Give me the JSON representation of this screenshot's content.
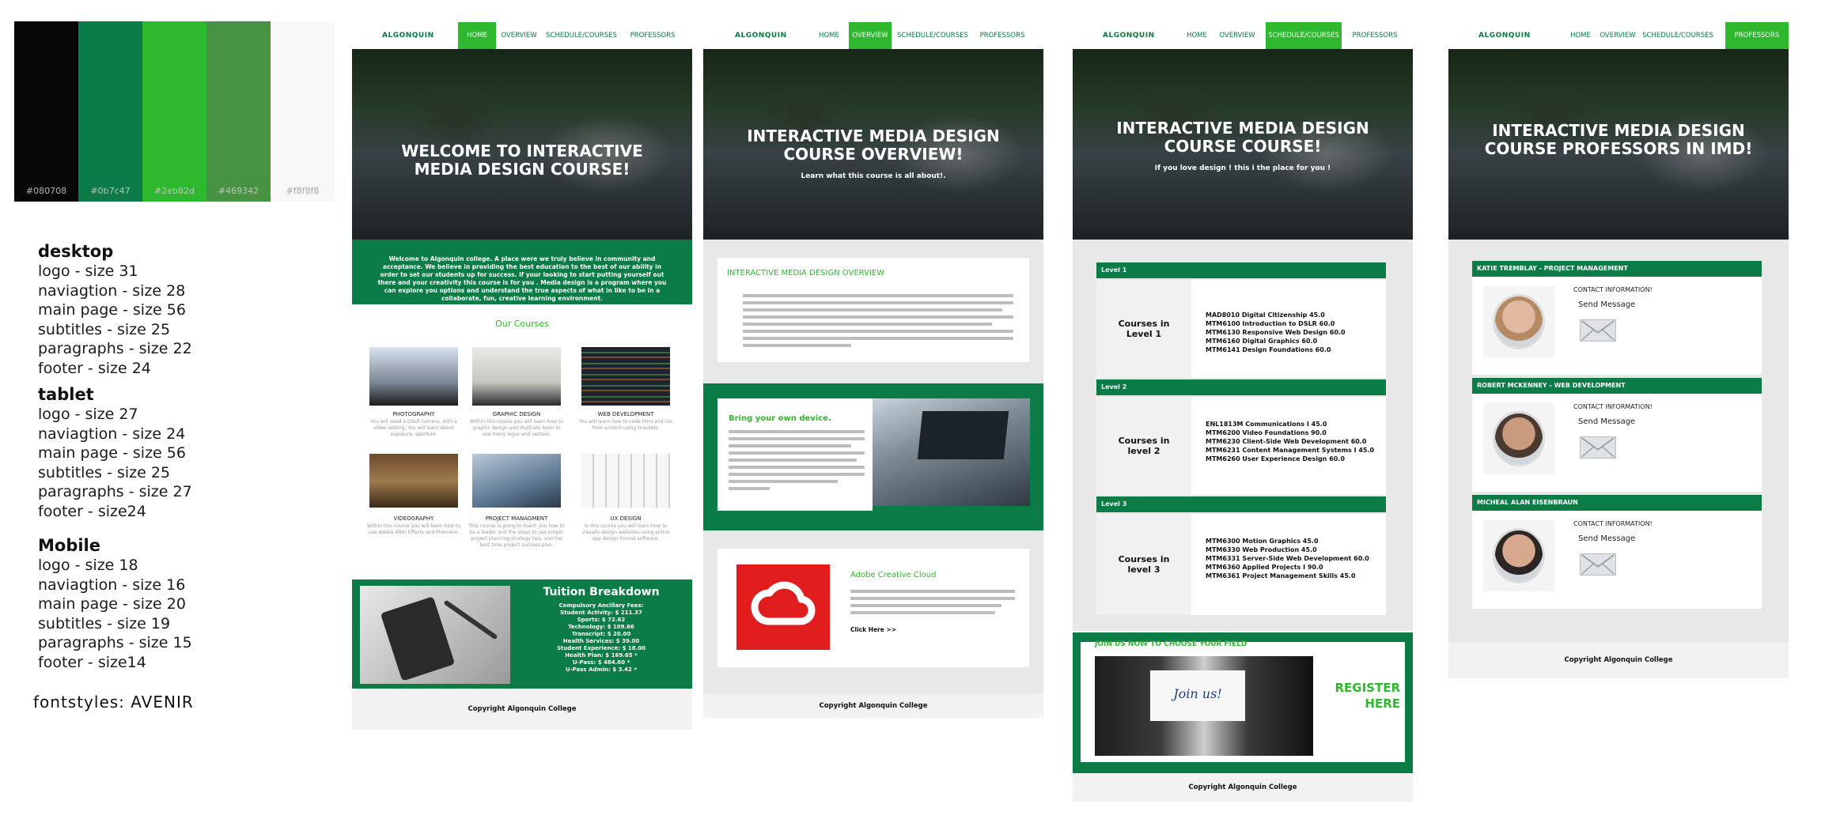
{
  "palette": [
    {
      "hex": "#080708",
      "label": "#080708"
    },
    {
      "hex": "#0b7c47",
      "label": "#0b7c47"
    },
    {
      "hex": "#2eb82d",
      "label": "#2eb82d"
    },
    {
      "hex": "#469342",
      "label": "#469342"
    },
    {
      "hex": "#f8f8f8",
      "label": "#f8f8f8"
    }
  ],
  "spec": {
    "desktop": {
      "heading": "desktop",
      "lines": [
        "logo - size 31",
        "naviagtion - size 28",
        "main page - size 56",
        "subtitles - size 25",
        "paragraphs - size 22",
        "footer - size 24"
      ]
    },
    "tablet": {
      "heading": "tablet",
      "lines": [
        "logo - size 27",
        "naviagtion - size 24",
        "main page - size 56",
        "subtitles - size 25",
        "paragraphs -  size 27",
        "footer - size24"
      ]
    },
    "mobile": {
      "heading": "Mobile",
      "lines": [
        "logo - size 18",
        "naviagtion - size 16",
        "main page - size 20",
        "subtitles - size 19",
        "paragraphs - size 15",
        "footer - size14"
      ]
    },
    "fontstyles": "fontstyles:  AVENIR"
  },
  "nav": {
    "logo": "ALGONQUIN",
    "home": "HOME",
    "overview": "OVERVIEW",
    "schedule": "SCHEDULE/COURSES",
    "professors": "PROFESSORS"
  },
  "home": {
    "hero_line1": "WELCOME TO INTERACTIVE",
    "hero_line2": "MEDIA DESIGN COURSE!",
    "welcome": "Welcome to Algonquin college. A place were we truly believe in community and acceptance. We believe in providing the best education to the best of our ability in order to set our students up for success. If your looking to start putting yourself out there and your  creativity this course is for you .  Media design is a program where you can explore you options and understand the true aspects of what in like to be in a collaborate, fun, creative  learning environment.",
    "courses_heading": "Our Courses",
    "courses": [
      {
        "title": "PHOTOGRAPHY",
        "desc": "You will need a DSLR camera, with a video setting. You will learn about exposure, aperture."
      },
      {
        "title": "GRAPHIC DESIGN",
        "desc": "Within this course you will learn how to graphic design and illustrate learn to use many logos and vectors."
      },
      {
        "title": "WEB DEVELOPMENT",
        "desc": "You will learn how to code html and css from scratch using brackets."
      },
      {
        "title": "VIDEOGRAPHY",
        "desc": "Within this course you will learn how to use Adobe After Effects and Premiere."
      },
      {
        "title": "PROJECT MANAGMENT",
        "desc": "This course is going to teach you how to be a leader and the steps to use proper project planning strategy tips, and the best time project success plan."
      },
      {
        "title": "UX DESIGN",
        "desc": "In this course you will learn how to visually design websites using online app design format software."
      }
    ],
    "tuition_title": "Tuition Breakdown",
    "fees": [
      "Compulsory Ancillary Fees:",
      "Student Activity: $ 211.37",
      "Sports: $ 72.62",
      "Technology: $ 109.66",
      "Transcript: $ 20.00",
      "Health Services: $ 39.00",
      "Student Experience: $ 18.00",
      "Health Plan: $ 169.65 *",
      "U-Pass: $ 484.60 *",
      "U-Pass Admin: $ 3.42 *"
    ],
    "footer": "Copyright Algonquin College"
  },
  "overview": {
    "hero_line1": "INTERACTIVE MEDIA DESIGN",
    "hero_line2": "COURSE OVERVIEW!",
    "hero_sub": "Learn what this course is all about!.",
    "section_title": "INTERACTIVE MEDIA DESIGN OVERVIEW",
    "device_title": "Bring your own device.",
    "adobe_title": "Adobe Creative Cloud",
    "click_here": "Click Here >>",
    "footer": "Copyright  Algonquin College"
  },
  "schedule": {
    "hero_line1": "INTERACTIVE MEDIA DESIGN",
    "hero_line2": "COURSE COURSE!",
    "hero_sub": "If you love design ! this i the place for you !",
    "levels": [
      {
        "bar": "Level 1",
        "label_1": "Courses in",
        "label_2": "Level 1",
        "courses": [
          "MAD8010 Digital Citizenship   45.0",
          "MTM6100 Introduction to DSLR   60.0",
          "MTM6130 Responsive Web Design   60.0",
          "MTM6160 Digital Graphics   60.0",
          "MTM6141 Design Foundations 60.0"
        ]
      },
      {
        "bar": "Level 2",
        "label_1": "Courses in",
        "label_2": "level 2",
        "courses": [
          "ENL1813M Communications I   45.0",
          "MTM6200 Video Foundations  90.0",
          "MTM6230 Client-Side Web Development   60.0",
          "MTM6231 Content Management Systems I   45.0",
          "MTM6260 User Experience Design   60.0"
        ]
      },
      {
        "bar": "Level 3",
        "label_1": "Courses in",
        "label_2": "level 3",
        "courses": [
          "MTM6300 Motion Graphics  45.0",
          "MTM6330 Web Production   45.0",
          "MTM6331 Server-Side Web Development  60.0",
          "MTM6360 Applied Projects I   90.0",
          "MTM6361 Project Management Skills   45.0"
        ]
      }
    ],
    "join_title": "JOIN US NOW TO CHOOSE YOUR FIELD",
    "join_card": "Join us!",
    "register_1": "REGISTER",
    "register_2": "HERE",
    "footer": "Copyright Algonquin College"
  },
  "professors": {
    "hero_line1": "INTERACTIVE MEDIA DESIGN",
    "hero_line2": "COURSE PROFESSORS IN IMD!",
    "profs": [
      {
        "name": "KATIE TREMBLAY - PROJECT MANAGEMENT",
        "contact": "CONTACT INFORMATION!",
        "send": "Send Message",
        "skin": "#e0b9a0",
        "hair": "#b58a62"
      },
      {
        "name": "ROBERT MCKENNEY - WEB DEVELOPMENT",
        "contact": "CONTACT INFORMATION!",
        "send": "Send Message",
        "skin": "#c99a7d",
        "hair": "#4a3a30"
      },
      {
        "name": "MICHEAL ALAN EISENBRAUN",
        "contact": "CONTACT INFORMATION!",
        "send": "Send Message",
        "skin": "#d8a88e",
        "hair": "#2b2523"
      }
    ],
    "footer": "Copyright Algonquin College"
  }
}
